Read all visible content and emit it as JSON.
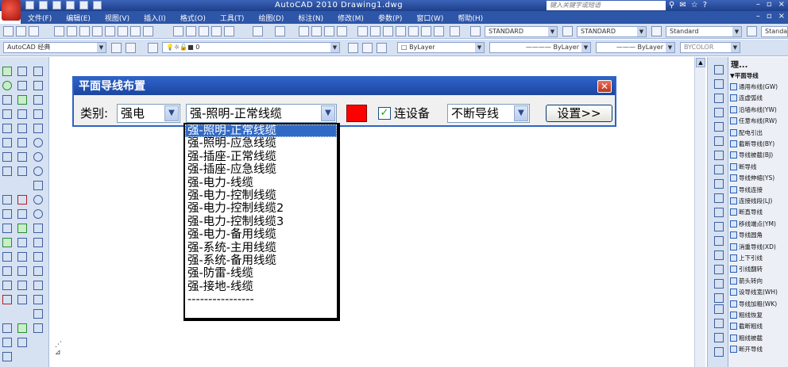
{
  "window": {
    "title": "AutoCAD 2010   Drawing1.dwg",
    "search_placeholder": "键入关键字或短语"
  },
  "menu": [
    "文件(F)",
    "编辑(E)",
    "视图(V)",
    "插入(I)",
    "格式(O)",
    "工具(T)",
    "绘图(D)",
    "标注(N)",
    "修改(M)",
    "参数(P)",
    "窗口(W)",
    "帮助(H)"
  ],
  "toolbar": {
    "style1": "STANDARD",
    "style2": "STANDARD",
    "style3": "Standard",
    "style4": "Standard",
    "workspace": "AutoCAD 经典",
    "layer": "0",
    "color": "ByLayer",
    "linetype": "ByLayer",
    "lineweight": "ByLayer",
    "plotstyle": "BYCOLOR"
  },
  "dialog": {
    "title": "平面导线布置",
    "category_label": "类别:",
    "category_value": "强电",
    "cable_value": "强-照明-正常线缆",
    "connect_label": "连设备",
    "connect_checked": true,
    "mode_value": "不断导线",
    "settings_label": "设置>>",
    "swatch_color": "#ff0000"
  },
  "dropdown": {
    "selected_index": 0,
    "items": [
      "强-照明-正常线缆",
      "强-照明-应急线缆",
      "强-插座-正常线缆",
      "强-插座-应急线缆",
      "强-电力-线缆",
      "强-电力-控制线缆",
      "强-电力-控制线缆2",
      "强-电力-控制线缆3",
      "强-电力-备用线缆",
      "强-系统-主用线缆",
      "强-系统-备用线缆",
      "强-防雷-线缆",
      "强-接地-线缆",
      "----------------"
    ]
  },
  "right_panel": {
    "header": "理...",
    "items": [
      {
        "label": "▼平面导线",
        "section": true
      },
      {
        "label": "通用布线(GW)"
      },
      {
        "label": "连虚弧线"
      },
      {
        "label": "沿墙布线(YW)"
      },
      {
        "label": "任意布线(RW)"
      },
      {
        "label": "配电引出"
      },
      {
        "label": "截断导线(BY)"
      },
      {
        "label": "导线被截(BJ)"
      },
      {
        "label": "断导线"
      },
      {
        "label": "导线伸缩(YS)"
      },
      {
        "label": "导线连接"
      },
      {
        "label": "连接线段(LJ)"
      },
      {
        "label": "断直导线"
      },
      {
        "label": "移线端点(YM)"
      },
      {
        "label": "导线圆角"
      },
      {
        "label": "消重导线(XD)"
      },
      {
        "label": "上下引线"
      },
      {
        "label": "引线翻转"
      },
      {
        "label": "箭头转向"
      },
      {
        "label": "设导线宽(WH)"
      },
      {
        "label": "导线加粗(WK)"
      },
      {
        "label": "粗线恢复"
      },
      {
        "label": "截断粗线"
      },
      {
        "label": "粗线被截"
      },
      {
        "label": "断开导线"
      }
    ]
  }
}
